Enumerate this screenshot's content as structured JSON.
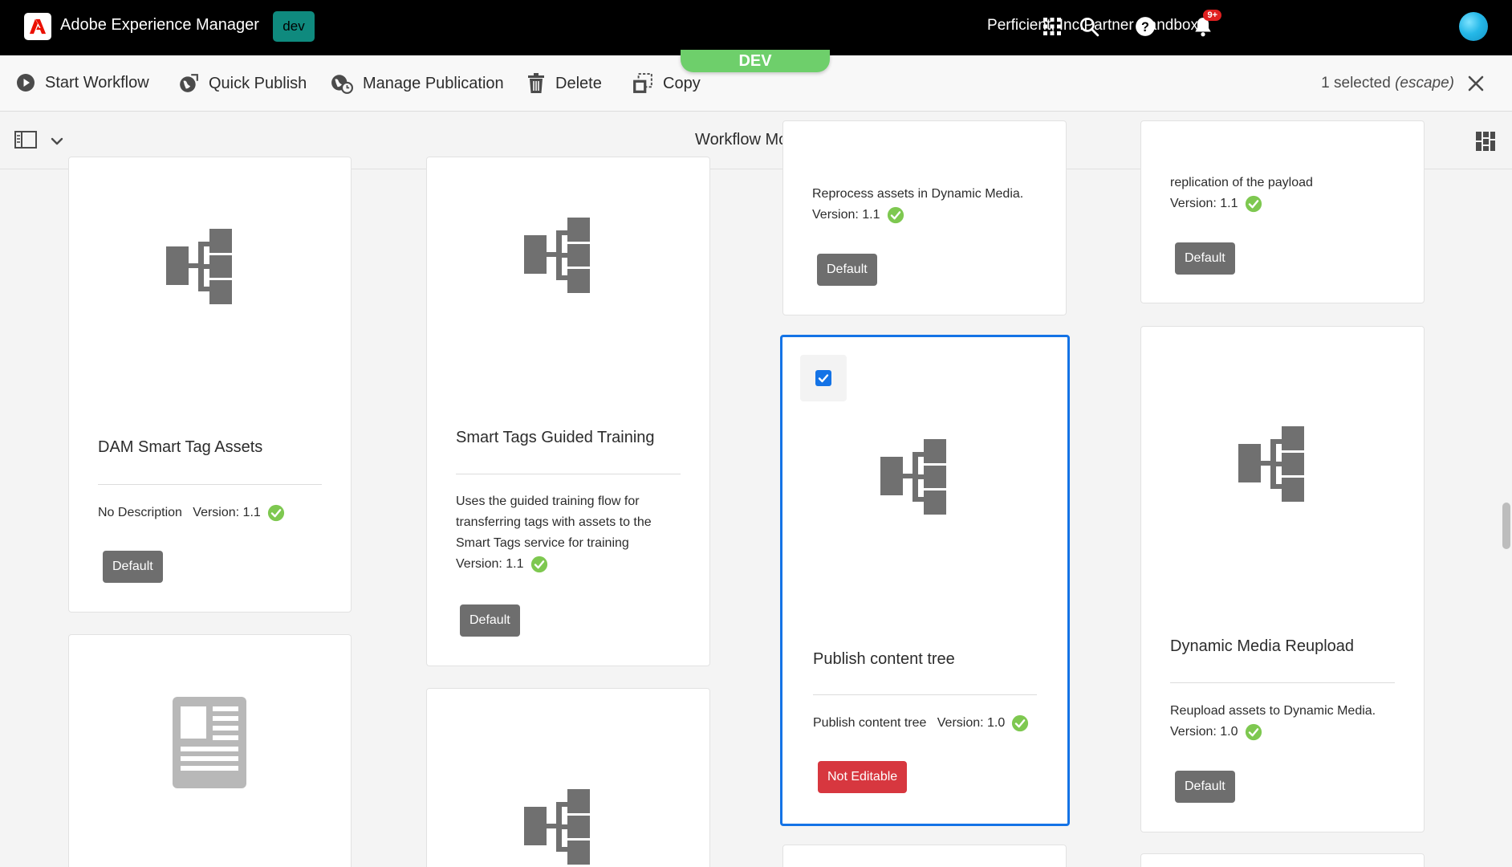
{
  "topbar": {
    "app_title": "Adobe Experience Manager",
    "env_badge": "dev",
    "org_name": "Perficient, Inc.Partner Sandbox",
    "notifications_count": "9+"
  },
  "env_pill": "DEV",
  "actions": {
    "start_workflow": "Start Workflow",
    "quick_publish": "Quick Publish",
    "manage_publication": "Manage Publication",
    "delete": "Delete",
    "copy": "Copy"
  },
  "selection": {
    "count_text": "1 selected",
    "hint": "(escape)"
  },
  "view": {
    "title": "Workflow Models"
  },
  "cards": {
    "dam_smart_tag": {
      "title": "DAM Smart Tag Assets",
      "description": "No Description",
      "version": "Version: 1.1",
      "tag": "Default"
    },
    "smart_tags_training": {
      "title": "Smart Tags Guided Training",
      "description": "Uses the guided training flow for transferring tags with assets to the Smart Tags service for training",
      "version": "Version: 1.1",
      "tag": "Default"
    },
    "reprocess": {
      "description": "Reprocess assets in Dynamic Media.",
      "version": "Version: 1.1",
      "tag": "Default"
    },
    "replication": {
      "description": "replication of the payload",
      "version": "Version: 1.1",
      "tag": "Default"
    },
    "publish_tree": {
      "title": "Publish content tree",
      "description": "Publish content tree",
      "version": "Version: 1.0",
      "tag": "Not Editable"
    },
    "dm_reupload": {
      "title": "Dynamic Media Reupload",
      "description": "Reupload assets to Dynamic Media.",
      "version": "Version: 1.0",
      "tag": "Default"
    }
  },
  "colors": {
    "accent": "#1473e6",
    "env_badge": "#0f8a7e",
    "dev_pill": "#6ecf6b",
    "tag_default": "#6e6e6e",
    "tag_not_editable": "#d7373f",
    "check_green": "#7ec850"
  }
}
